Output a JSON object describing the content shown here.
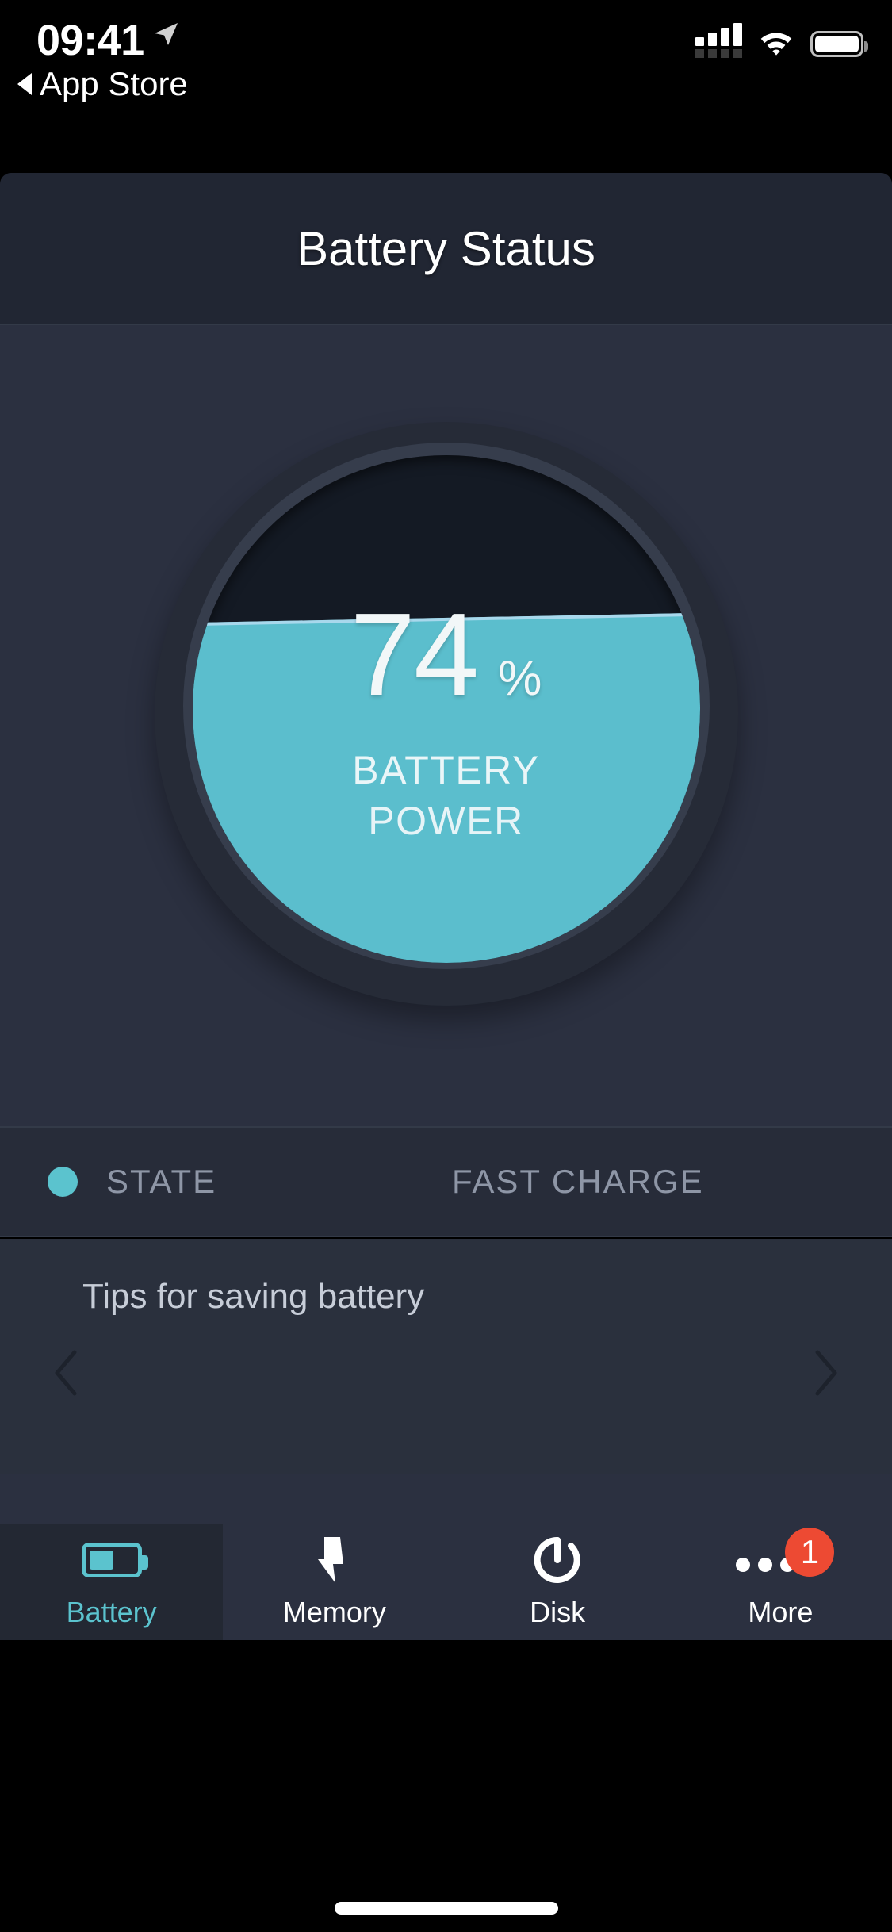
{
  "status_bar": {
    "time": "09:41",
    "back_label": "App Store",
    "location_icon": "location-arrow-icon",
    "signal_icon": "cellular-signal-icon",
    "wifi_icon": "wifi-icon",
    "battery_icon": "battery-full-icon"
  },
  "header": {
    "title": "Battery Status"
  },
  "gauge": {
    "percent_value": "74",
    "percent_sign": "%",
    "label_line1": "BATTERY",
    "label_line2": "POWER",
    "fill_level": 74,
    "fill_color": "#5bbecd",
    "highlight_color": "#a8d8ec",
    "dial_color": "#141a24"
  },
  "state_row": {
    "indicator_icon": "status-dot-icon",
    "indicator_color": "#5bc3ce",
    "key": "STATE",
    "value": "FAST CHARGE"
  },
  "tips": {
    "title": "Tips for saving battery",
    "prev_icon": "chevron-left-icon",
    "next_icon": "chevron-right-icon"
  },
  "tab_bar": {
    "active_color": "#5bc3ce",
    "inactive_color": "#ffffff",
    "badge_color": "#ed4a33",
    "tabs": [
      {
        "label": "Battery",
        "icon": "battery-icon",
        "active": true,
        "badge": null
      },
      {
        "label": "Memory",
        "icon": "lightning-bolt-icon",
        "active": false,
        "badge": null
      },
      {
        "label": "Disk",
        "icon": "disk-refresh-icon",
        "active": false,
        "badge": null
      },
      {
        "label": "More",
        "icon": "ellipsis-icon",
        "active": false,
        "badge": "1"
      }
    ]
  }
}
